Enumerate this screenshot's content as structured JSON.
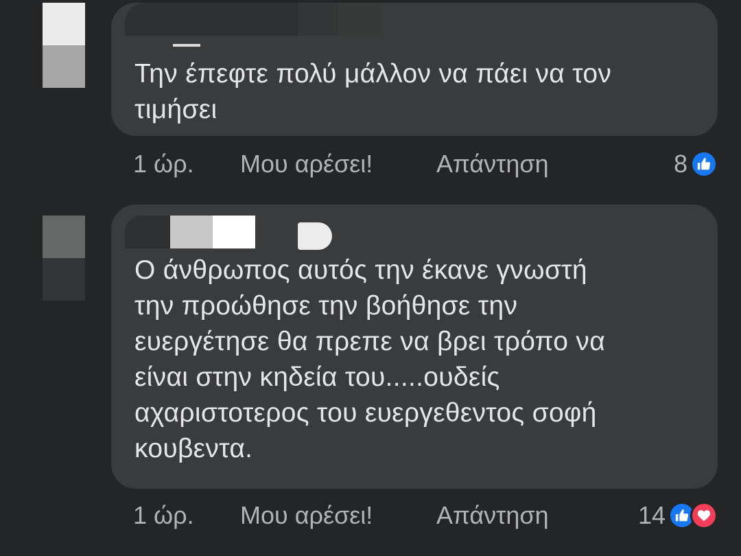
{
  "comments": [
    {
      "text": "Την έπεφτε πολύ μάλλον να πάει να τον\nτιμήσει",
      "time": "1 ώρ.",
      "like_label": "Μου αρέσει!",
      "reply_label": "Απάντηση",
      "reaction_count": "8",
      "reactions": [
        "like-icon"
      ]
    },
    {
      "text": "Ο άνθρωπος αυτός την έκανε γνωστή\nτην προώθησε την βοήθησε την\nευεργέτησε θα πρεπε να βρει τρόπο να\nείναι στην κηδεία του.....ουδείς\nαχαριστοτερος του ευεργεθεντος σοφή\nκουβεντα.",
      "time": "1 ώρ.",
      "like_label": "Μου αρέσει!",
      "reply_label": "Απάντηση",
      "reaction_count": "14",
      "reactions": [
        "like-icon",
        "love-icon"
      ]
    }
  ],
  "colors": {
    "background": "#242526",
    "bubble": "#3a3b3c",
    "text": "#e4e6eb",
    "secondary_text": "#b0b3b8",
    "like_blue": "#1877f2",
    "love_red": "#f33e58"
  }
}
